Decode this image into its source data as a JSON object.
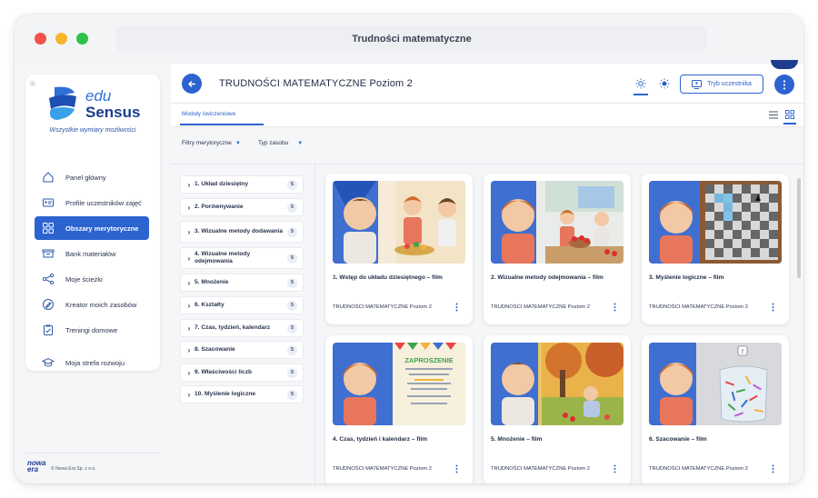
{
  "window": {
    "title": "Trudności matematyczne"
  },
  "brand": {
    "line1": "edu",
    "line2": "Sensus",
    "tagline": "Wszystkie wymiary możliwości"
  },
  "sidebar": {
    "items": [
      {
        "label": "Panel główny",
        "icon": "home-icon"
      },
      {
        "label": "Profile uczestników zajęć",
        "icon": "id-card-icon"
      },
      {
        "label": "Obszary merytoryczne",
        "icon": "grid-icon",
        "active": true
      },
      {
        "label": "Bank materiałów",
        "icon": "box-icon"
      },
      {
        "label": "Moje ścieżki",
        "icon": "path-icon"
      },
      {
        "label": "Kreator moich zasobów",
        "icon": "pen-icon"
      },
      {
        "label": "Treningi domowe",
        "icon": "clipboard-icon"
      },
      {
        "label": "Moja strefa rozwoju",
        "icon": "cap-icon"
      }
    ],
    "footer_logo": "nowa era",
    "footer_copy": "© Nowa Era Sp. z o.o."
  },
  "header": {
    "title": "TRUDNOŚCI MATEMATYCZNE Poziom 2",
    "mode_button": "Tryb uczestnika"
  },
  "tabs": {
    "active": "Moduły ćwiczeniowe"
  },
  "filters": [
    {
      "label": "Filtry merytoryczne"
    },
    {
      "label": "Typ zasobu"
    }
  ],
  "topics": [
    {
      "label": "1. Układ dziesiętny",
      "count": "5"
    },
    {
      "label": "2. Porównywanie",
      "count": "5"
    },
    {
      "label": "3. Wizualne metody dodawania",
      "count": "5"
    },
    {
      "label": "4. Wizualne metody odejmowania",
      "count": "5"
    },
    {
      "label": "5. Mnożenie",
      "count": "5"
    },
    {
      "label": "6. Kształty",
      "count": "5"
    },
    {
      "label": "7. Czas, tydzień, kalendarz",
      "count": "5"
    },
    {
      "label": "8. Szacowanie",
      "count": "5"
    },
    {
      "label": "9. Właściwości liczb",
      "count": "5"
    },
    {
      "label": "10. Myślenie logiczne",
      "count": "5"
    }
  ],
  "cards": [
    {
      "title": "1. Wstęp do układu dziesiętnego – film",
      "subtitle": "TRUDNOŚCI MATEMATYCZNE Poziom 2"
    },
    {
      "title": "2. Wizualne metody odejmowania – film",
      "subtitle": "TRUDNOŚCI MATEMATYCZNE Poziom 2"
    },
    {
      "title": "3. Myślenie logiczne – film",
      "subtitle": "TRUDNOŚCI MATEMATYCZNE Poziom 2"
    },
    {
      "title": "4. Czas, tydzień i kalendarz – film",
      "subtitle": "TRUDNOŚCI MATEMATYCZNE Poziom 2",
      "poster_title": "ZAPROSZENIE"
    },
    {
      "title": "5. Mnożenie – film",
      "subtitle": "TRUDNOŚCI MATEMATYCZNE Poziom 2"
    },
    {
      "title": "6. Szacowanie – film",
      "subtitle": "TRUDNOŚCI MATEMATYCZNE Poziom 2"
    }
  ],
  "colors": {
    "accent": "#2c63cf",
    "brand_dark": "#1d3c8f"
  }
}
